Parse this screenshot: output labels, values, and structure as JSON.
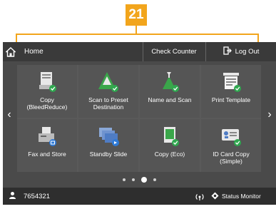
{
  "callout": {
    "number": "21"
  },
  "topbar": {
    "home_label": "Home",
    "check_counter_label": "Check Counter",
    "logout_label": "Log Out"
  },
  "tiles": [
    {
      "label": "Copy\n(BleedReduce)",
      "icon": "copy-icon"
    },
    {
      "label": "Scan to Preset\nDestination",
      "icon": "scan-preset-icon"
    },
    {
      "label": "Name and Scan",
      "icon": "name-scan-icon"
    },
    {
      "label": "Print Template",
      "icon": "print-template-icon"
    },
    {
      "label": "Fax and Store",
      "icon": "fax-store-icon"
    },
    {
      "label": "Standby Slide",
      "icon": "standby-slide-icon"
    },
    {
      "label": "Copy (Eco)",
      "icon": "copy-eco-icon"
    },
    {
      "label": "ID Card Copy\n(Simple)",
      "icon": "id-card-copy-icon"
    }
  ],
  "pagination": {
    "pages": 4,
    "active_page": 3
  },
  "statusbar": {
    "user_id": "7654321",
    "status_monitor_label": "Status Monitor"
  },
  "colors": {
    "accent": "#f2a51c",
    "badge_green": "#2fa84f",
    "screen_bg": "#4a4a4a"
  }
}
